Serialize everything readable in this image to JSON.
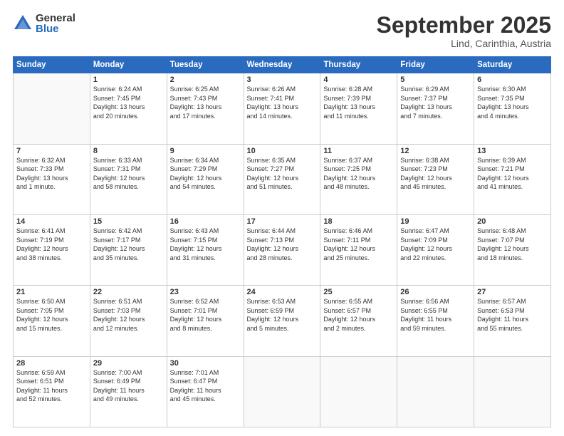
{
  "logo": {
    "general": "General",
    "blue": "Blue"
  },
  "header": {
    "month": "September 2025",
    "location": "Lind, Carinthia, Austria"
  },
  "weekdays": [
    "Sunday",
    "Monday",
    "Tuesday",
    "Wednesday",
    "Thursday",
    "Friday",
    "Saturday"
  ],
  "weeks": [
    [
      {
        "day": "",
        "info": ""
      },
      {
        "day": "1",
        "info": "Sunrise: 6:24 AM\nSunset: 7:45 PM\nDaylight: 13 hours\nand 20 minutes."
      },
      {
        "day": "2",
        "info": "Sunrise: 6:25 AM\nSunset: 7:43 PM\nDaylight: 13 hours\nand 17 minutes."
      },
      {
        "day": "3",
        "info": "Sunrise: 6:26 AM\nSunset: 7:41 PM\nDaylight: 13 hours\nand 14 minutes."
      },
      {
        "day": "4",
        "info": "Sunrise: 6:28 AM\nSunset: 7:39 PM\nDaylight: 13 hours\nand 11 minutes."
      },
      {
        "day": "5",
        "info": "Sunrise: 6:29 AM\nSunset: 7:37 PM\nDaylight: 13 hours\nand 7 minutes."
      },
      {
        "day": "6",
        "info": "Sunrise: 6:30 AM\nSunset: 7:35 PM\nDaylight: 13 hours\nand 4 minutes."
      }
    ],
    [
      {
        "day": "7",
        "info": "Sunrise: 6:32 AM\nSunset: 7:33 PM\nDaylight: 13 hours\nand 1 minute."
      },
      {
        "day": "8",
        "info": "Sunrise: 6:33 AM\nSunset: 7:31 PM\nDaylight: 12 hours\nand 58 minutes."
      },
      {
        "day": "9",
        "info": "Sunrise: 6:34 AM\nSunset: 7:29 PM\nDaylight: 12 hours\nand 54 minutes."
      },
      {
        "day": "10",
        "info": "Sunrise: 6:35 AM\nSunset: 7:27 PM\nDaylight: 12 hours\nand 51 minutes."
      },
      {
        "day": "11",
        "info": "Sunrise: 6:37 AM\nSunset: 7:25 PM\nDaylight: 12 hours\nand 48 minutes."
      },
      {
        "day": "12",
        "info": "Sunrise: 6:38 AM\nSunset: 7:23 PM\nDaylight: 12 hours\nand 45 minutes."
      },
      {
        "day": "13",
        "info": "Sunrise: 6:39 AM\nSunset: 7:21 PM\nDaylight: 12 hours\nand 41 minutes."
      }
    ],
    [
      {
        "day": "14",
        "info": "Sunrise: 6:41 AM\nSunset: 7:19 PM\nDaylight: 12 hours\nand 38 minutes."
      },
      {
        "day": "15",
        "info": "Sunrise: 6:42 AM\nSunset: 7:17 PM\nDaylight: 12 hours\nand 35 minutes."
      },
      {
        "day": "16",
        "info": "Sunrise: 6:43 AM\nSunset: 7:15 PM\nDaylight: 12 hours\nand 31 minutes."
      },
      {
        "day": "17",
        "info": "Sunrise: 6:44 AM\nSunset: 7:13 PM\nDaylight: 12 hours\nand 28 minutes."
      },
      {
        "day": "18",
        "info": "Sunrise: 6:46 AM\nSunset: 7:11 PM\nDaylight: 12 hours\nand 25 minutes."
      },
      {
        "day": "19",
        "info": "Sunrise: 6:47 AM\nSunset: 7:09 PM\nDaylight: 12 hours\nand 22 minutes."
      },
      {
        "day": "20",
        "info": "Sunrise: 6:48 AM\nSunset: 7:07 PM\nDaylight: 12 hours\nand 18 minutes."
      }
    ],
    [
      {
        "day": "21",
        "info": "Sunrise: 6:50 AM\nSunset: 7:05 PM\nDaylight: 12 hours\nand 15 minutes."
      },
      {
        "day": "22",
        "info": "Sunrise: 6:51 AM\nSunset: 7:03 PM\nDaylight: 12 hours\nand 12 minutes."
      },
      {
        "day": "23",
        "info": "Sunrise: 6:52 AM\nSunset: 7:01 PM\nDaylight: 12 hours\nand 8 minutes."
      },
      {
        "day": "24",
        "info": "Sunrise: 6:53 AM\nSunset: 6:59 PM\nDaylight: 12 hours\nand 5 minutes."
      },
      {
        "day": "25",
        "info": "Sunrise: 6:55 AM\nSunset: 6:57 PM\nDaylight: 12 hours\nand 2 minutes."
      },
      {
        "day": "26",
        "info": "Sunrise: 6:56 AM\nSunset: 6:55 PM\nDaylight: 11 hours\nand 59 minutes."
      },
      {
        "day": "27",
        "info": "Sunrise: 6:57 AM\nSunset: 6:53 PM\nDaylight: 11 hours\nand 55 minutes."
      }
    ],
    [
      {
        "day": "28",
        "info": "Sunrise: 6:59 AM\nSunset: 6:51 PM\nDaylight: 11 hours\nand 52 minutes."
      },
      {
        "day": "29",
        "info": "Sunrise: 7:00 AM\nSunset: 6:49 PM\nDaylight: 11 hours\nand 49 minutes."
      },
      {
        "day": "30",
        "info": "Sunrise: 7:01 AM\nSunset: 6:47 PM\nDaylight: 11 hours\nand 45 minutes."
      },
      {
        "day": "",
        "info": ""
      },
      {
        "day": "",
        "info": ""
      },
      {
        "day": "",
        "info": ""
      },
      {
        "day": "",
        "info": ""
      }
    ]
  ]
}
